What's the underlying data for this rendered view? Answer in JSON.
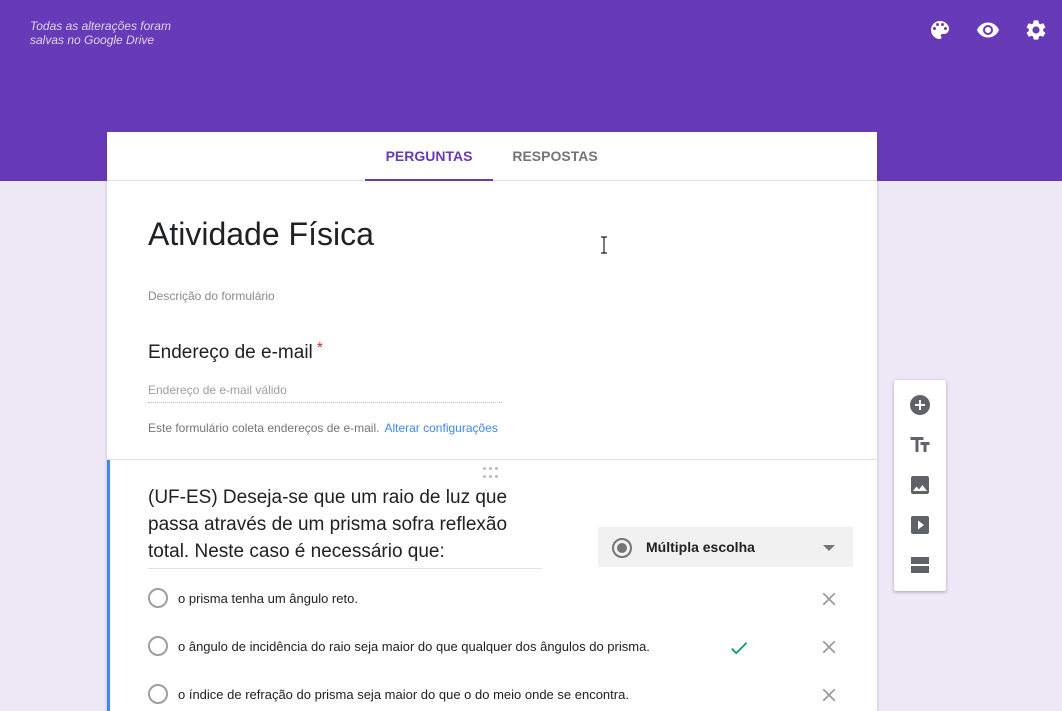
{
  "header": {
    "save_status": "Todas as alterações foram salvas no Google Drive",
    "icons": [
      "palette-icon",
      "eye-preview-icon",
      "gear-settings-icon"
    ],
    "color": "#673ab7"
  },
  "tabs": [
    {
      "label": "PERGUNTAS",
      "active": true
    },
    {
      "label": "RESPOSTAS",
      "active": false
    }
  ],
  "form": {
    "title": "Atividade Física",
    "description_placeholder": "Descrição do formulário"
  },
  "email_question": {
    "title": "Endereço de e-mail",
    "required_mark": "*",
    "input_placeholder": "Endereço de e-mail válido",
    "note": "Este formulário coleta endereços de e-mail.",
    "note_link": "Alterar configurações"
  },
  "question": {
    "text": "(UF-ES) Deseja-se que um raio de luz que passa através de um prisma sofra reflexão total. Neste caso é necessário que:",
    "type": "Múltipla escolha",
    "options": [
      {
        "label": "o prisma tenha um ângulo reto.",
        "correct": false
      },
      {
        "label": "o ângulo de incidência do raio seja maior do que qualquer dos ângulos do prisma.",
        "correct": true
      },
      {
        "label": "o índice de refração do prisma seja maior do que o do meio onde se encontra.",
        "correct": false
      }
    ]
  },
  "side_toolbar": {
    "tools": [
      "add-question-icon",
      "add-title-icon",
      "add-image-icon",
      "add-video-icon",
      "add-section-icon"
    ]
  },
  "colors": {
    "accent": "#673ab7",
    "background": "#ede7f6",
    "active_border": "#4285f4",
    "correct": "#0f9d58",
    "link": "#4285f4",
    "required": "#d93025"
  }
}
